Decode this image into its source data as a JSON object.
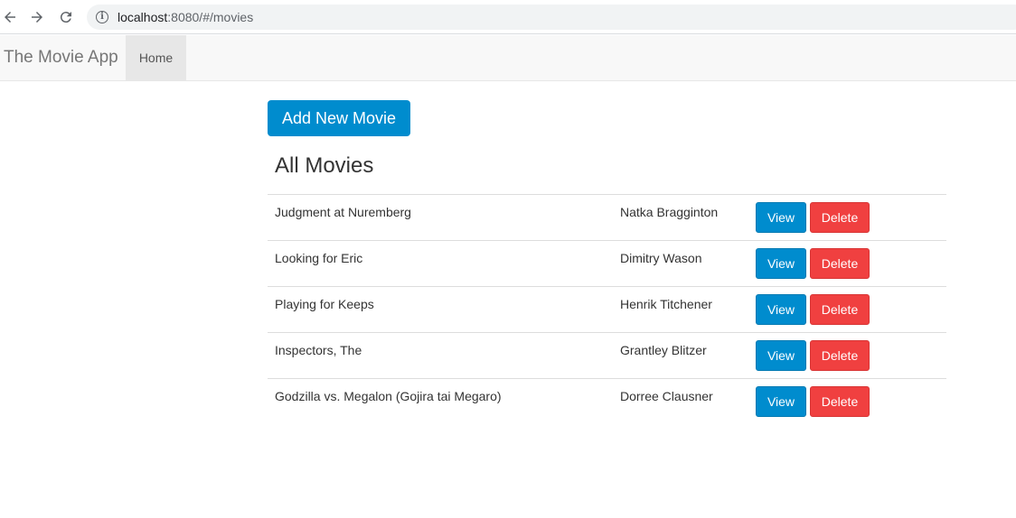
{
  "browser": {
    "url_host": "localhost",
    "url_path": ":8080/#/movies"
  },
  "navbar": {
    "brand": "The Movie App",
    "home_label": "Home"
  },
  "main": {
    "add_button_label": "Add New Movie",
    "title": "All Movies",
    "view_label": "View",
    "delete_label": "Delete",
    "movies": [
      {
        "title": "Judgment at Nuremberg",
        "director": "Natka Bragginton"
      },
      {
        "title": "Looking for Eric",
        "director": "Dimitry Wason"
      },
      {
        "title": "Playing for Keeps",
        "director": "Henrik Titchener"
      },
      {
        "title": "Inspectors, The",
        "director": "Grantley Blitzer"
      },
      {
        "title": "Godzilla vs. Megalon (Gojira tai Megaro)",
        "director": "Dorree Clausner"
      }
    ]
  },
  "colors": {
    "primary": "#008cce",
    "danger": "#f04040"
  }
}
